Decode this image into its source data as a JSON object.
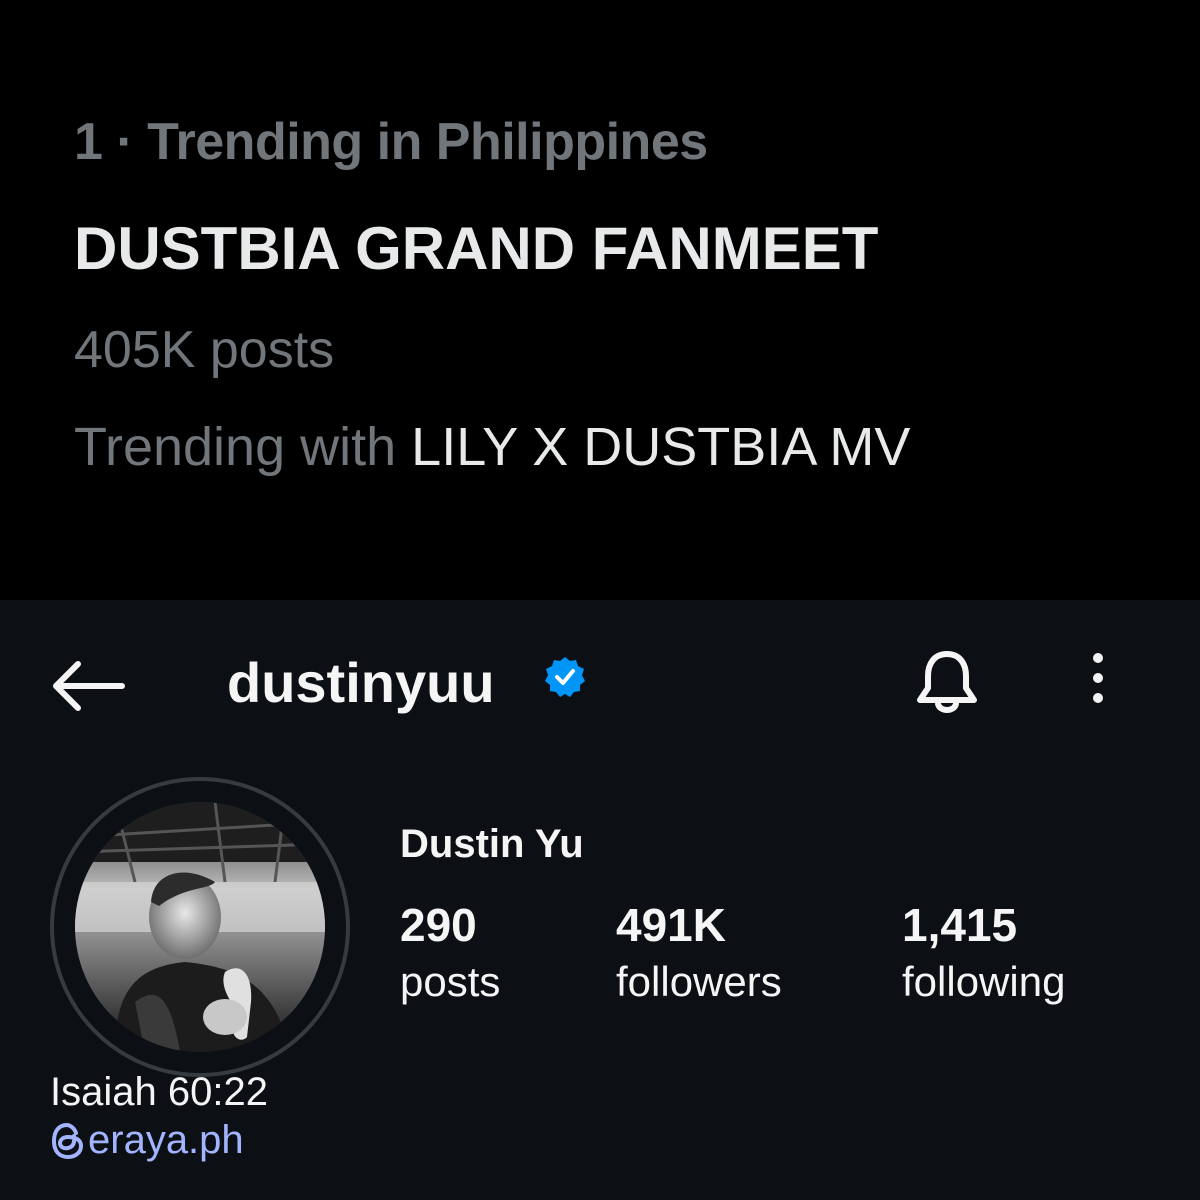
{
  "trend": {
    "meta": "1 · Trending in Philippines",
    "title": "DUSTBIA GRAND FANMEET",
    "posts": "405K posts",
    "with_prefix": "Trending with ",
    "with_topic": "LILY X DUSTBIA MV"
  },
  "profile": {
    "header": {
      "back_icon": "arrow-left-icon",
      "username": "dustinyuu",
      "verified_icon": "verified-badge-icon",
      "bell_icon": "bell-icon",
      "more_icon": "more-vertical-icon"
    },
    "full_name": "Dustin Yu",
    "stats": [
      {
        "value": "290",
        "label": "posts"
      },
      {
        "value": "491K",
        "label": "followers"
      },
      {
        "value": "1,415",
        "label": "following"
      }
    ],
    "bio": "Isaiah 60:22",
    "link_icon": "threads-icon",
    "link": "eraya.ph"
  },
  "colors": {
    "trend_bg": "#000000",
    "profile_bg": "#0c1014",
    "muted": "#71767b",
    "text": "#f5f5f5",
    "verified": "#0095f6",
    "link": "#a2b4ff"
  }
}
